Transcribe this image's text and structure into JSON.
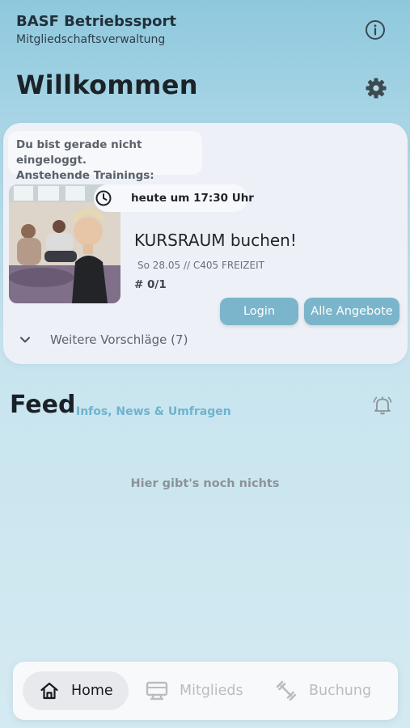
{
  "header": {
    "app_title": "BASF Betriebssport",
    "app_subtitle": "Mitgliedschaftsverwaltung",
    "page_title": "Willkommen",
    "info_icon": "info-icon",
    "settings_icon": "gear-icon"
  },
  "card": {
    "status_line1": "Du bist gerade nicht eingeloggt.",
    "status_line2": "Anstehende Trainings:",
    "time": "heute um 17:30 Uhr",
    "course_title": "KURSRAUM buchen!",
    "course_meta": "So 28.05 // C405 FREIZEIT",
    "course_count": "# 0/1",
    "login_label": "Login",
    "all_offers_label": "Alle Angebote",
    "more_label": "Weitere Vorschläge (7)"
  },
  "feed": {
    "title": "Feed",
    "subtitle": "Infos, News & Umfragen",
    "empty": "Hier gibt's noch nichts"
  },
  "nav": {
    "items": [
      {
        "label": "Home",
        "icon": "home-icon",
        "active": true
      },
      {
        "label": "Mitglieds",
        "icon": "membership-card-icon",
        "active": false
      },
      {
        "label": "Buchung",
        "icon": "dumbbell-icon",
        "active": false
      }
    ]
  },
  "colors": {
    "accent": "#7bb5cb",
    "link": "#6fb2ce",
    "card_bg": "#eef0f7"
  }
}
